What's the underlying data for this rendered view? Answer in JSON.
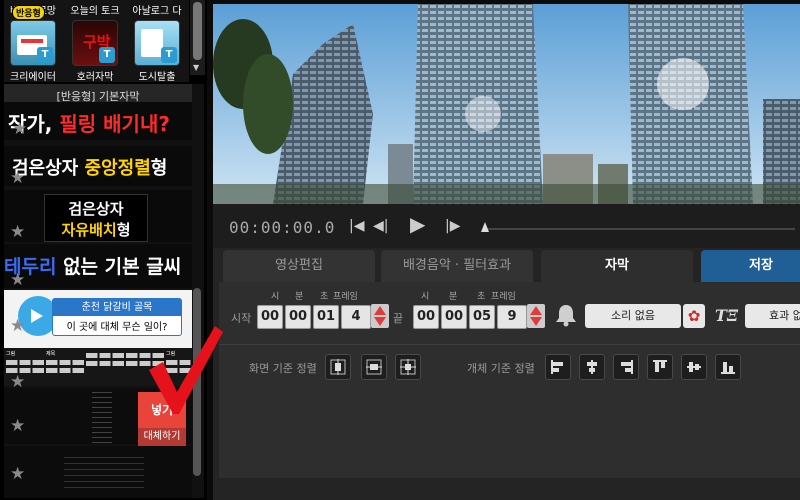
{
  "categories": [
    {
      "top": "바캉스로망",
      "bottom": "크리에이터",
      "badge": "반응형",
      "thumb_bg": "#5fb8d6"
    },
    {
      "top": "오늘의 토크",
      "bottom": "호러자막",
      "badge": "",
      "thumb_bg": "#5a1a1a",
      "text": "구박"
    },
    {
      "top": "아날로그 다",
      "bottom": "도시탈출",
      "badge": "",
      "thumb_bg": "#7fc6e8"
    }
  ],
  "panel": {
    "header": "[반응형] 기본자막",
    "templates": [
      {
        "pre": "작가, ",
        "accent": "필링 배기내?"
      },
      {
        "pre": "검은상자 ",
        "accent": "중앙정렬",
        "post": "형"
      },
      {
        "line1": "검은상자",
        "accent": "자유배치",
        "post": "형"
      },
      {
        "accent": "테두리",
        "post": " 없는 기본 글씨"
      },
      {
        "banner": "춘천 닭갈비 골목",
        "sub": "이 곳에 대체 무슨 일이?"
      }
    ],
    "mini_tiles": [
      "그림",
      "제목",
      "",
      "",
      "그림"
    ],
    "insert_label": "넣기",
    "replace_label": "대체하기"
  },
  "player": {
    "timecode": "00:00:00.0",
    "progress": 0.0
  },
  "tabs": [
    "영상편집",
    "배경음악 · 필터효과",
    "자막",
    "저장"
  ],
  "active_tab": "자막",
  "subtitle": {
    "start_label": "시작",
    "end_label": "끝",
    "field_labels": [
      "시",
      "분",
      "초",
      "프레임"
    ],
    "start_values": [
      "00",
      "00",
      "01",
      "4"
    ],
    "end_values": [
      "00",
      "00",
      "05",
      "9"
    ],
    "sound_label": "소리 없음",
    "effect_label": "효과 없",
    "screen_align_label": "화면 기준 정렬",
    "object_align_label": "개체 기준 정렬"
  },
  "colors": {
    "accent_red": "#e23b3b",
    "save_blue": "#1f5f95",
    "check_red": "#e5121b"
  }
}
